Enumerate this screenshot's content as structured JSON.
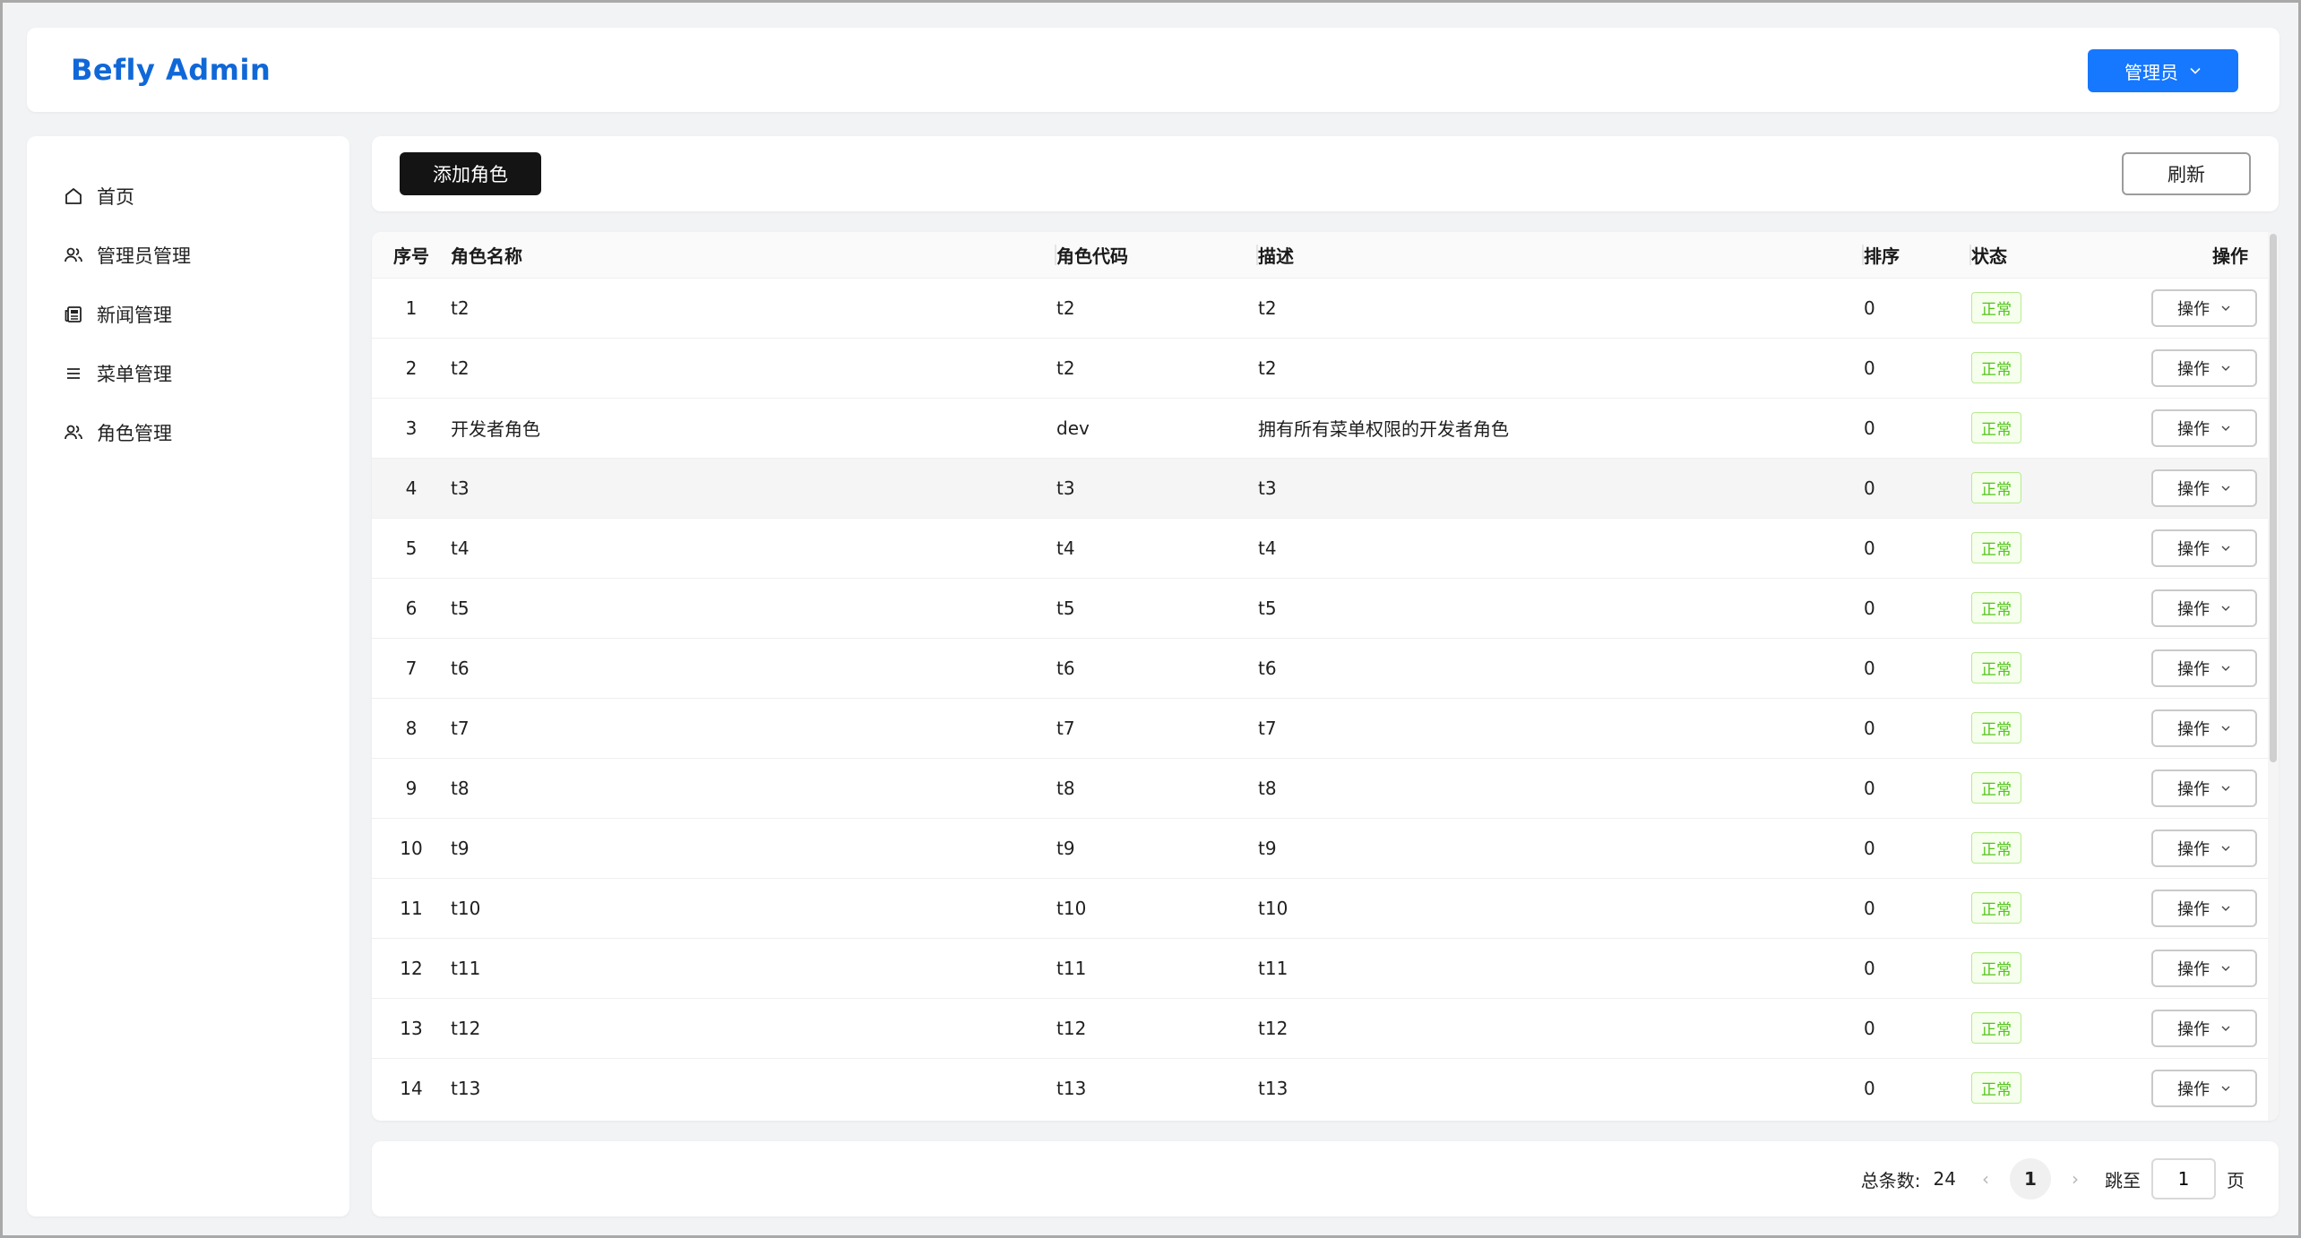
{
  "header": {
    "brand": "Befly Admin",
    "user_button": "管理员"
  },
  "sidebar": {
    "items": [
      {
        "label": "首页",
        "icon": "home-icon"
      },
      {
        "label": "管理员管理",
        "icon": "users-icon"
      },
      {
        "label": "新闻管理",
        "icon": "news-icon"
      },
      {
        "label": "菜单管理",
        "icon": "menu-icon"
      },
      {
        "label": "角色管理",
        "icon": "users-icon"
      }
    ]
  },
  "toolbar": {
    "add_label": "添加角色",
    "refresh_label": "刷新"
  },
  "table": {
    "columns": [
      "序号",
      "角色名称",
      "角色代码",
      "描述",
      "排序",
      "状态",
      "操作"
    ],
    "action_label": "操作",
    "rows": [
      {
        "idx": "1",
        "name": "t2",
        "code": "t2",
        "desc": "t2",
        "sort": "0",
        "status": "正常"
      },
      {
        "idx": "2",
        "name": "t2",
        "code": "t2",
        "desc": "t2",
        "sort": "0",
        "status": "正常"
      },
      {
        "idx": "3",
        "name": "开发者角色",
        "code": "dev",
        "desc": "拥有所有菜单权限的开发者角色",
        "sort": "0",
        "status": "正常"
      },
      {
        "idx": "4",
        "name": "t3",
        "code": "t3",
        "desc": "t3",
        "sort": "0",
        "status": "正常"
      },
      {
        "idx": "5",
        "name": "t4",
        "code": "t4",
        "desc": "t4",
        "sort": "0",
        "status": "正常"
      },
      {
        "idx": "6",
        "name": "t5",
        "code": "t5",
        "desc": "t5",
        "sort": "0",
        "status": "正常"
      },
      {
        "idx": "7",
        "name": "t6",
        "code": "t6",
        "desc": "t6",
        "sort": "0",
        "status": "正常"
      },
      {
        "idx": "8",
        "name": "t7",
        "code": "t7",
        "desc": "t7",
        "sort": "0",
        "status": "正常"
      },
      {
        "idx": "9",
        "name": "t8",
        "code": "t8",
        "desc": "t8",
        "sort": "0",
        "status": "正常"
      },
      {
        "idx": "10",
        "name": "t9",
        "code": "t9",
        "desc": "t9",
        "sort": "0",
        "status": "正常"
      },
      {
        "idx": "11",
        "name": "t10",
        "code": "t10",
        "desc": "t10",
        "sort": "0",
        "status": "正常"
      },
      {
        "idx": "12",
        "name": "t11",
        "code": "t11",
        "desc": "t11",
        "sort": "0",
        "status": "正常"
      },
      {
        "idx": "13",
        "name": "t12",
        "code": "t12",
        "desc": "t12",
        "sort": "0",
        "status": "正常"
      },
      {
        "idx": "14",
        "name": "t13",
        "code": "t13",
        "desc": "t13",
        "sort": "0",
        "status": "正常"
      }
    ]
  },
  "pagination": {
    "total_label": "总条数:",
    "total": "24",
    "current_page": "1",
    "jump_label": "跳至",
    "jump_value": "1",
    "page_suffix": "页"
  },
  "colors": {
    "brand": "#1068d8",
    "primary": "#1677ff",
    "success": "#52c41a",
    "dark_button": "#141414"
  }
}
